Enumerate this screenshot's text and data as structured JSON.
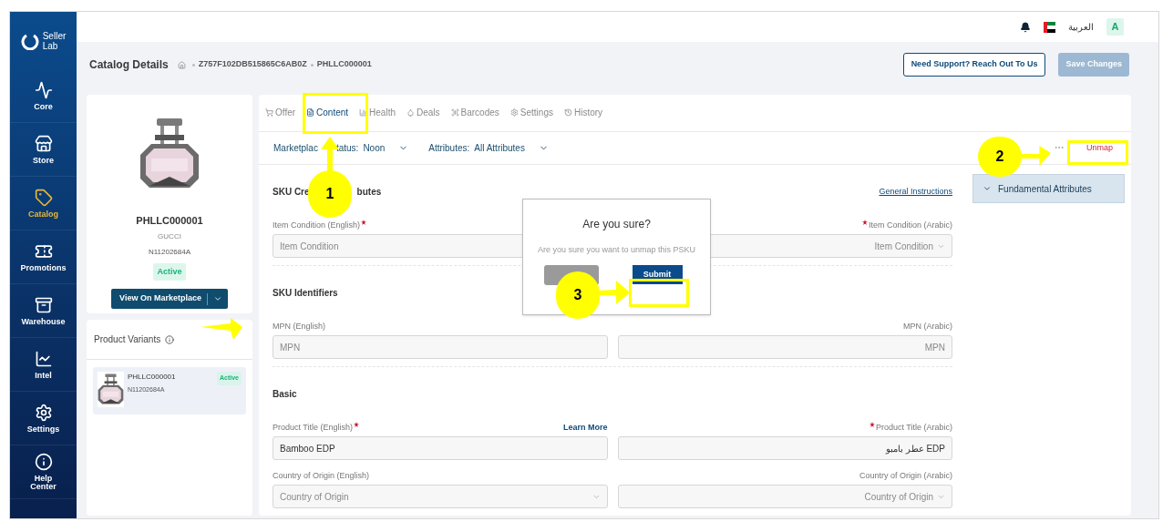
{
  "sidebar": {
    "logo_lines": [
      "Seller",
      "Lab"
    ],
    "items": [
      {
        "label": "Core",
        "selected": false
      },
      {
        "label": "Store",
        "selected": false
      },
      {
        "label": "Catalog",
        "selected": true
      },
      {
        "label": "Promotions",
        "selected": false
      },
      {
        "label": "Warehouse",
        "selected": false
      },
      {
        "label": "Intel",
        "selected": false
      },
      {
        "label": "Settings",
        "selected": false
      },
      {
        "label": "Help Center",
        "selected": false
      }
    ]
  },
  "topbar": {
    "language": "العربية",
    "avatar": "A"
  },
  "header": {
    "title": "Catalog Details",
    "breadcrumb": [
      "Z757F102DB515865C6AB0Z",
      "PHLLC000001"
    ],
    "support_button": "Need Support? Reach Out To Us",
    "save_button": {
      "label": "Save Changes",
      "disabled": true
    }
  },
  "product_card": {
    "sku": "PHLLC000001",
    "brand": "GUCCI",
    "code": "N11202684A",
    "status": "Active",
    "button": "View On Marketplace"
  },
  "variants": {
    "title": "Product Variants",
    "items": [
      {
        "sku": "PHLLC000001",
        "code": "N11202684A",
        "status": "Active",
        "selected": true
      }
    ]
  },
  "tabs": [
    {
      "label": "Offer",
      "selected": false
    },
    {
      "label": "Content",
      "selected": true
    },
    {
      "label": "Health",
      "selected": false
    },
    {
      "label": "Deals",
      "selected": false
    },
    {
      "label": "Barcodes",
      "selected": false
    },
    {
      "label": "Settings",
      "selected": false
    },
    {
      "label": "History",
      "selected": false
    }
  ],
  "filters": [
    {
      "label_parts": [
        "Marketplac",
        "tatus:"
      ],
      "value": "Noon"
    },
    {
      "label_parts": [
        "Attributes:"
      ],
      "value": "All Attributes"
    }
  ],
  "unmap_button": "Unmap",
  "accordion": {
    "label": "Fundamental Attributes",
    "expanded": true
  },
  "sections": [
    {
      "title_parts": [
        "SKU Cre",
        "butes"
      ],
      "link": "General Instructions",
      "rows": [
        [
          {
            "label": "Item Condition (English)",
            "required": true,
            "kind": "text",
            "placeholder": "Item Condition"
          },
          {
            "label": "Item Condition (Arabic)",
            "required": true,
            "kind": "select",
            "placeholder": "Item Condition"
          }
        ]
      ]
    },
    {
      "title_parts": [
        "SKU Identifiers"
      ],
      "rows": [
        [
          {
            "label": "MPN (English)",
            "required": false,
            "kind": "text",
            "placeholder": "MPN"
          },
          {
            "label": "MPN (Arabic)",
            "required": false,
            "kind": "text",
            "placeholder": "MPN"
          }
        ]
      ]
    },
    {
      "title_parts": [
        "Basic"
      ],
      "rows": [
        [
          {
            "label": "Product Title (English)",
            "required": true,
            "kind": "text",
            "value": "Bamboo EDP",
            "link": "Learn More"
          },
          {
            "label": "Product Title (Arabic)",
            "required": true,
            "kind": "text",
            "value": "عطر بامبو EDP"
          }
        ],
        [
          {
            "label": "Country of Origin (English)",
            "required": false,
            "kind": "select",
            "placeholder": "Country of Origin"
          },
          {
            "label": "Country of Origin (Arabic)",
            "required": false,
            "kind": "select",
            "placeholder": "Country of Origin"
          }
        ]
      ]
    }
  ],
  "dialog": {
    "title": "Are you sure?",
    "message": "Are you sure you want to unmap this PSKU",
    "submit": "Submit"
  },
  "annotations": [
    {
      "number": "1"
    },
    {
      "number": "2"
    },
    {
      "number": "3"
    }
  ]
}
